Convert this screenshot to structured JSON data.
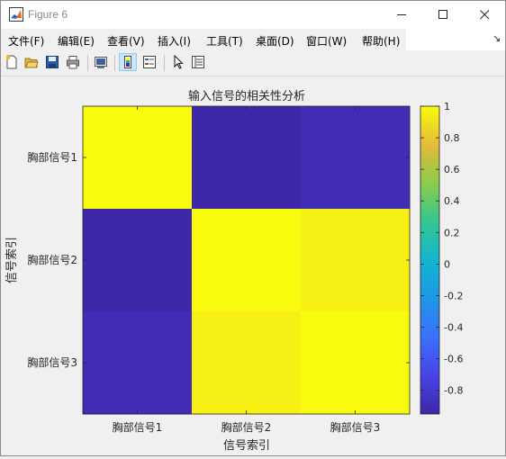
{
  "window": {
    "title": "Figure 6"
  },
  "menu": [
    "文件(F)",
    "编辑(E)",
    "查看(V)",
    "插入(I)",
    "工具(T)",
    "桌面(D)",
    "窗口(W)",
    "帮助(H)"
  ],
  "toolbar": {
    "icons": [
      "new-figure-icon",
      "open-file-icon",
      "save-icon",
      "print-icon",
      "link-plot-icon",
      "colorbar-icon",
      "legend-icon",
      "pointer-icon",
      "property-inspector-icon"
    ]
  },
  "colors": {
    "yellow": "#f9fb0e",
    "yellow_dim": "#f1ea28",
    "blue_dark": "#3b2fad",
    "blue_mid": "#3e37c0",
    "blue_light": "#4139cc"
  },
  "chart_data": {
    "type": "heatmap",
    "title": "输入信号的相关性分析",
    "xlabel": "信号索引",
    "ylabel": "信号索引",
    "x_categories": [
      "胸部信号1",
      "胸部信号2",
      "胸部信号3"
    ],
    "y_categories": [
      "胸部信号1",
      "胸部信号2",
      "胸部信号3"
    ],
    "values": [
      [
        1.0,
        -0.95,
        -0.9
      ],
      [
        -0.95,
        1.0,
        0.96
      ],
      [
        -0.9,
        0.96,
        1.0
      ]
    ],
    "colorbar": {
      "colormap": "parula",
      "range": [
        -0.95,
        1.0
      ],
      "ticks": [
        1,
        0.8,
        0.6,
        0.4,
        0.2,
        0,
        -0.2,
        -0.4,
        -0.6,
        -0.8
      ],
      "tick_labels": [
        "1",
        "0.8",
        "0.6",
        "0.4",
        "0.2",
        "0",
        "-0.2",
        "-0.4",
        "-0.6",
        "-0.8"
      ]
    }
  }
}
